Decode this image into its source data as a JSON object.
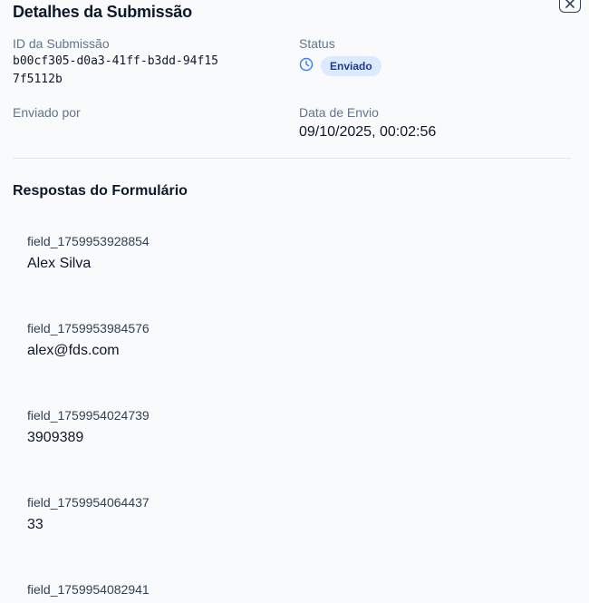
{
  "header": {
    "title": "Detalhes da Submissão",
    "close_icon": "close-icon"
  },
  "details": {
    "id_label": "ID da Submissão",
    "id_value": "b00cf305-d0a3-41ff-b3dd-94f157f5112b",
    "status_label": "Status",
    "status_icon": "clock-icon",
    "status_value": "Enviado",
    "submitted_by_label": "Enviado por",
    "date_label": "Data de Envio",
    "date_value": "09/10/2025, 00:02:56"
  },
  "answers_section": {
    "title": "Respostas do Formulário",
    "items": [
      {
        "field": "field_1759953928854",
        "value": "Alex Silva"
      },
      {
        "field": "field_1759953984576",
        "value": "alex@fds.com"
      },
      {
        "field": "field_1759954024739",
        "value": "3909389"
      },
      {
        "field": "field_1759954064437",
        "value": "33"
      },
      {
        "field": "field_1759954082941",
        "value": ""
      }
    ]
  },
  "colors": {
    "badge_bg": "#dbeafe",
    "badge_text": "#1e3a8a",
    "accent": "#3b82f6"
  }
}
